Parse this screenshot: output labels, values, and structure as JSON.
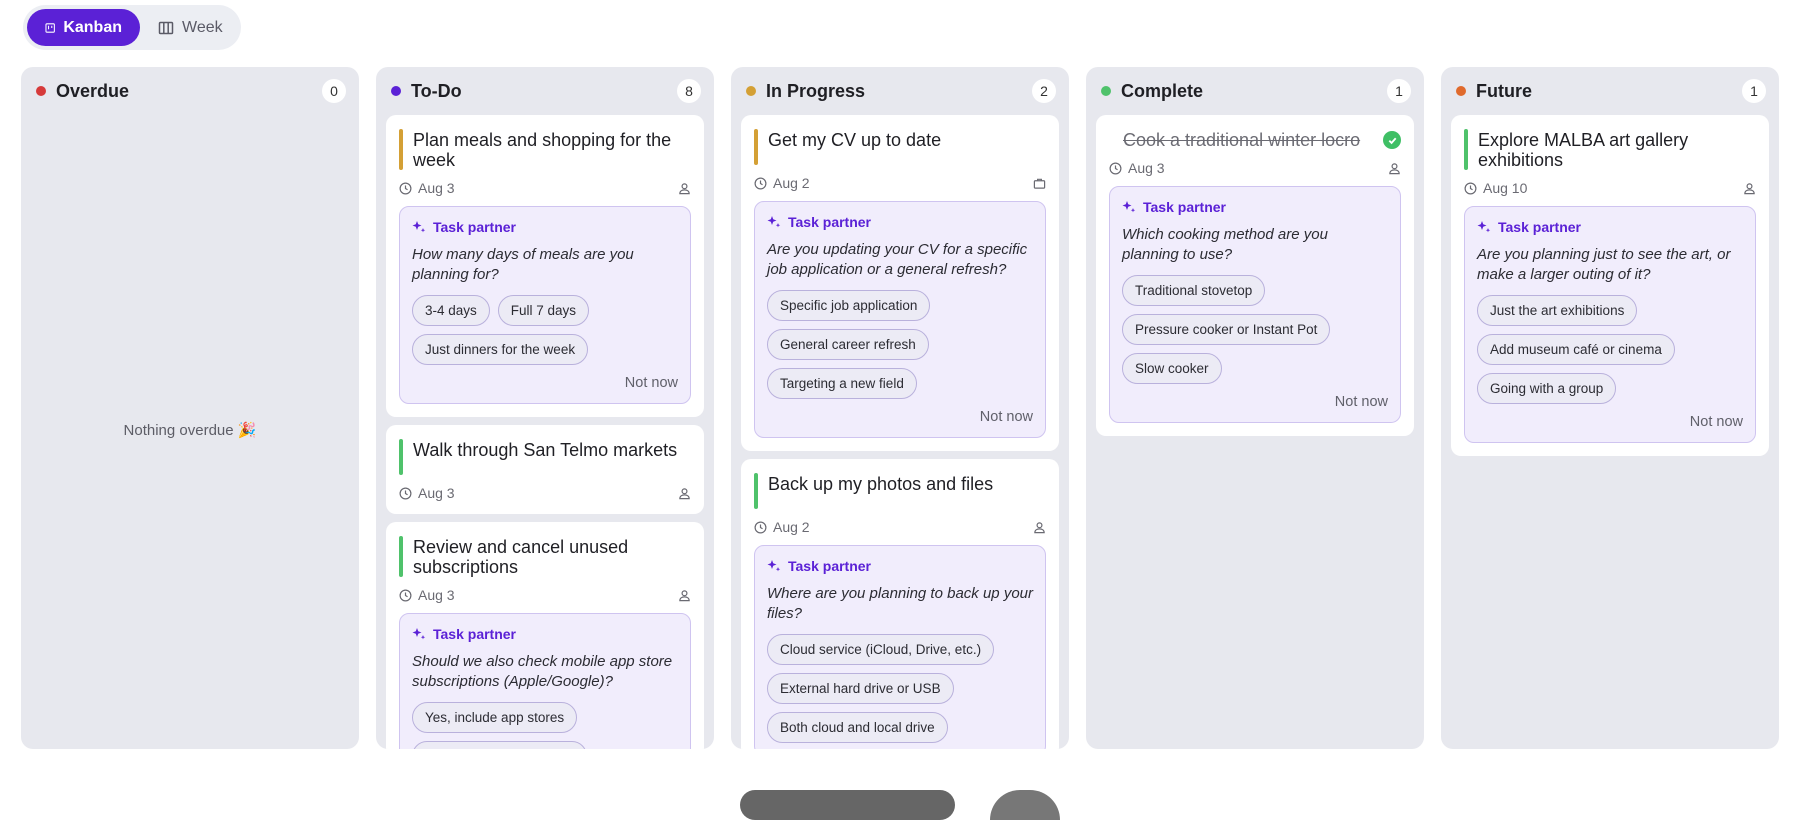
{
  "view_toggle": {
    "kanban_label": "Kanban",
    "week_label": "Week"
  },
  "partner_label": "Task partner",
  "not_now_label": "Not now",
  "columns": [
    {
      "title": "Overdue",
      "count": "0",
      "dot_color": "#d63a3a",
      "empty_message": "Nothing overdue 🎉"
    },
    {
      "title": "To-Do",
      "count": "8",
      "dot_color": "#5b21d6",
      "cards": [
        {
          "title": "Plan meals and shopping for the week",
          "date": "Aug 3",
          "bar_color": "#d4a035",
          "question": "How many days of meals are you planning for?",
          "options": [
            "3-4 days",
            "Full 7 days",
            "Just dinners for the week"
          ]
        },
        {
          "title": "Walk through San Telmo markets",
          "date": "Aug 3",
          "bar_color": "#4fc26b"
        },
        {
          "title": "Review and cancel unused subscriptions",
          "date": "Aug 3",
          "bar_color": "#4fc26b",
          "question": "Should we also check mobile app store subscriptions (Apple/Google)?",
          "options": [
            "Yes, include app stores"
          ]
        }
      ]
    },
    {
      "title": "In Progress",
      "count": "2",
      "dot_color": "#d4a035",
      "cards": [
        {
          "title": "Get my CV up to date",
          "date": "Aug 2",
          "bar_color": "#d4a035",
          "question": "Are you updating your CV for a specific job application or a general refresh?",
          "options": [
            "Specific job application",
            "General career refresh",
            "Targeting a new field"
          ]
        },
        {
          "title": "Back up my photos and files",
          "date": "Aug 2",
          "bar_color": "#4fc26b",
          "question": "Where are you planning to back up your files?",
          "options": [
            "Cloud service (iCloud, Drive, etc.)",
            "External hard drive or USB",
            "Both cloud and local drive"
          ]
        }
      ]
    },
    {
      "title": "Complete",
      "count": "1",
      "dot_color": "#4fc26b",
      "cards": [
        {
          "title": "Cook a traditional winter locro",
          "date": "Aug 3",
          "question": "Which cooking method are you planning to use?",
          "options": [
            "Traditional stovetop",
            "Pressure cooker or Instant Pot",
            "Slow cooker"
          ]
        }
      ]
    },
    {
      "title": "Future",
      "count": "1",
      "dot_color": "#e06a2c",
      "cards": [
        {
          "title": "Explore MALBA art gallery exhibitions",
          "date": "Aug 10",
          "bar_color": "#4fc26b",
          "question": "Are you planning just to see the art, or make a larger outing of it?",
          "options": [
            "Just the art exhibitions",
            "Add museum café or cinema",
            "Going with a group"
          ]
        }
      ]
    }
  ]
}
